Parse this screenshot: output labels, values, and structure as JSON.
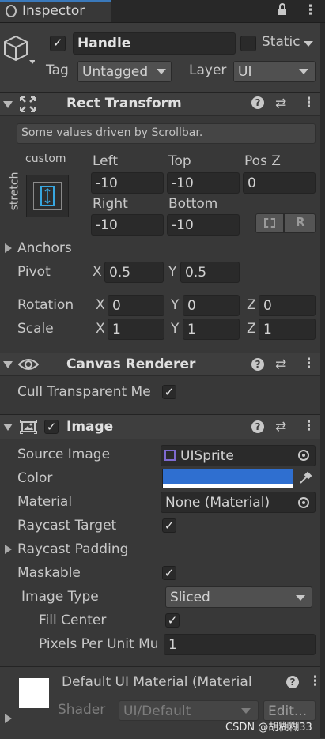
{
  "tab": {
    "title": "Inspector"
  },
  "gameobject": {
    "name": "Handle",
    "active": true,
    "static_label": "Static",
    "tag_label": "Tag",
    "tag_value": "Untagged",
    "layer_label": "Layer",
    "layer_value": "UI"
  },
  "rect_transform": {
    "title": "Rect Transform",
    "info": "Some values driven by Scrollbar.",
    "anchor_preset_label": "custom",
    "anchor_side_label": "stretch",
    "left_label": "Left",
    "left_value": "-10",
    "top_label": "Top",
    "top_value": "-10",
    "posz_label": "Pos Z",
    "posz_value": "0",
    "right_label": "Right",
    "right_value": "-10",
    "bottom_label": "Bottom",
    "bottom_value": "-10",
    "raw_button_label": "R",
    "anchors_label": "Anchors",
    "pivot_label": "Pivot",
    "pivot_x_label": "X",
    "pivot_x": "0.5",
    "pivot_y_label": "Y",
    "pivot_y": "0.5",
    "rotation_label": "Rotation",
    "rot_x_label": "X",
    "rot_x": "0",
    "rot_y_label": "Y",
    "rot_y": "0",
    "rot_z_label": "Z",
    "rot_z": "0",
    "scale_label": "Scale",
    "scale_x_label": "X",
    "scale_x": "1",
    "scale_y_label": "Y",
    "scale_y": "1",
    "scale_z_label": "Z",
    "scale_z": "1"
  },
  "canvas_renderer": {
    "title": "Canvas Renderer",
    "cull_label": "Cull Transparent Me",
    "cull_checked": true
  },
  "image": {
    "title": "Image",
    "enabled": true,
    "source_image_label": "Source Image",
    "source_image_value": "UISprite",
    "color_label": "Color",
    "color_value": "#2f6fd0",
    "material_label": "Material",
    "material_value": "None (Material)",
    "raycast_target_label": "Raycast Target",
    "raycast_target_checked": true,
    "raycast_padding_label": "Raycast Padding",
    "maskable_label": "Maskable",
    "maskable_checked": true,
    "image_type_label": "Image Type",
    "image_type_value": "Sliced",
    "fill_center_label": "Fill Center",
    "fill_center_checked": true,
    "ppu_label": "Pixels Per Unit Mu",
    "ppu_value": "1"
  },
  "material_preview": {
    "title": "Default UI Material (Material",
    "shader_label": "Shader",
    "shader_value": "UI/Default",
    "edit_label": "Edit..."
  },
  "watermark": "CSDN @胡糊糊33",
  "icons": {
    "more": "more-vertical-icon",
    "help": "help-icon",
    "presets": "presets-sliders-icon",
    "lock": "lock-icon"
  }
}
